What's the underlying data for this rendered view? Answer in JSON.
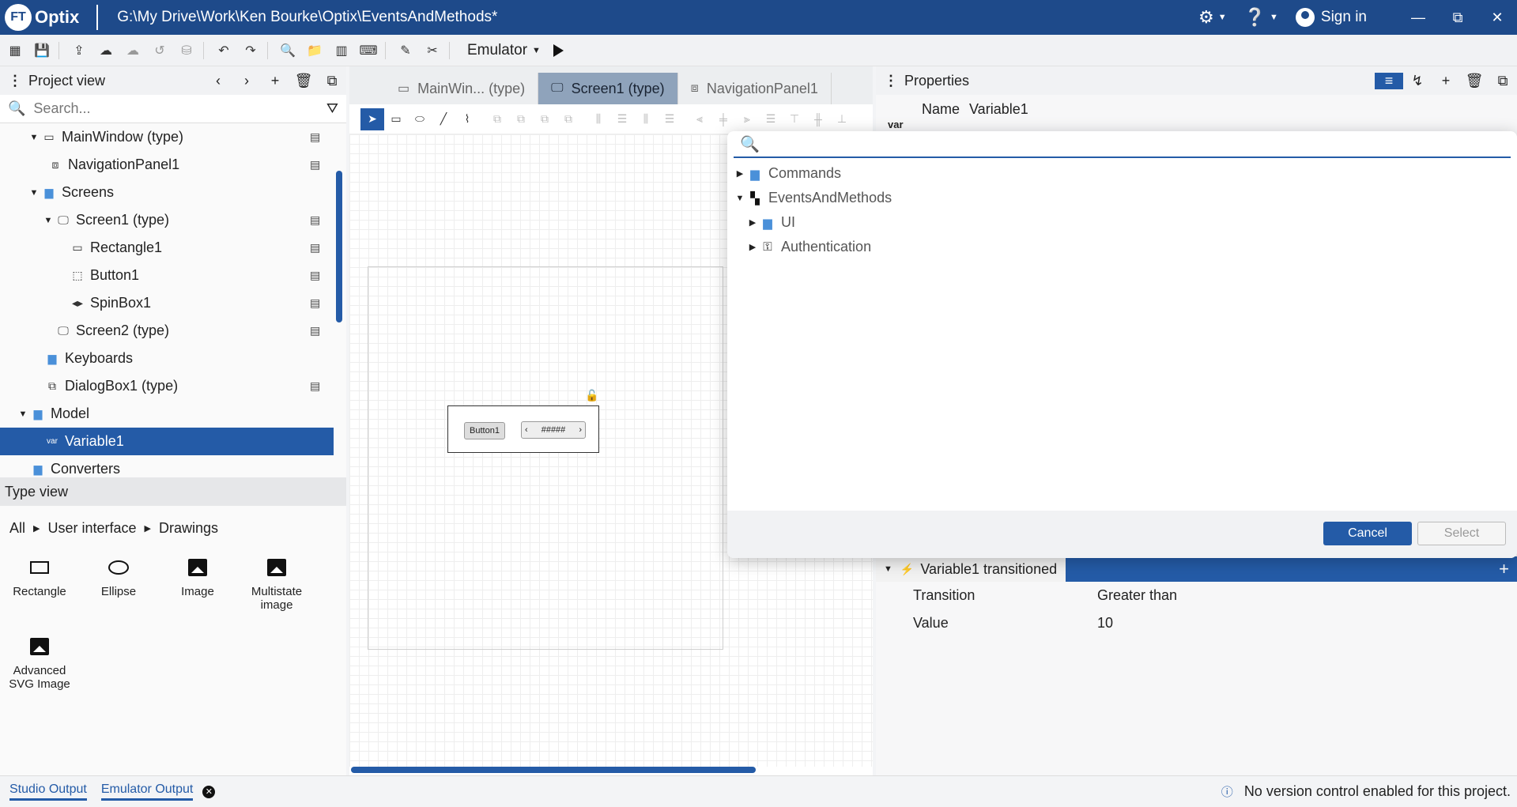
{
  "titlebar": {
    "logo_badge": "FT",
    "app_name": "Optix",
    "path": "G:\\My Drive\\Work\\Ken Bourke\\Optix\\EventsAndMethods*",
    "sign_in": "Sign in",
    "minimize": "—",
    "restore": "⧉",
    "close": "✕"
  },
  "toolbar": {
    "emulator_label": "Emulator"
  },
  "project_view": {
    "title": "Project view",
    "search_placeholder": "Search...",
    "tree": [
      {
        "label": "MainWindow (type)",
        "icon": "window-icon"
      },
      {
        "label": "NavigationPanel1",
        "icon": "navigation-panel-icon"
      },
      {
        "label": "Screens",
        "icon": "folder-icon"
      },
      {
        "label": "Screen1 (type)",
        "icon": "screen-icon"
      },
      {
        "label": "Rectangle1",
        "icon": "rectangle-icon"
      },
      {
        "label": "Button1",
        "icon": "button-icon"
      },
      {
        "label": "SpinBox1",
        "icon": "spinbox-icon"
      },
      {
        "label": "Screen2 (type)",
        "icon": "screen-icon"
      },
      {
        "label": "Keyboards",
        "icon": "folder-icon"
      },
      {
        "label": "DialogBox1 (type)",
        "icon": "dialog-icon"
      },
      {
        "label": "Model",
        "icon": "folder-icon"
      },
      {
        "label": "Variable1",
        "icon": "variable-icon",
        "tag": "var"
      },
      {
        "label": "Converters",
        "icon": "folder-icon"
      }
    ]
  },
  "type_view": {
    "title": "Type view",
    "breadcrumb": [
      "All",
      "User interface",
      "Drawings"
    ],
    "items": [
      {
        "label": "Rectangle"
      },
      {
        "label": "Ellipse"
      },
      {
        "label": "Image"
      },
      {
        "label": "Multistate image"
      },
      {
        "label": "Advanced SVG Image"
      }
    ]
  },
  "editor": {
    "tabs": [
      {
        "label": "MainWin... (type)"
      },
      {
        "label": "Screen1 (type)"
      },
      {
        "label": "NavigationPanel1"
      }
    ],
    "canvas": {
      "button_label": "Button1",
      "spin_value": "#####"
    }
  },
  "properties": {
    "title": "Properties",
    "var_tag": "var",
    "name_label": "Name",
    "name_value": "Variable1",
    "event_title": "Variable1 transitioned",
    "rows": [
      {
        "label": "Transition",
        "value": "Greater than"
      },
      {
        "label": "Value",
        "value": "10"
      }
    ]
  },
  "dialog": {
    "search_value": "",
    "tree": [
      {
        "label": "Commands"
      },
      {
        "label": "EventsAndMethods"
      },
      {
        "label": "UI"
      },
      {
        "label": "Authentication"
      }
    ],
    "cancel_label": "Cancel",
    "select_label": "Select"
  },
  "statusbar": {
    "studio_output": "Studio Output",
    "emulator_output": "Emulator Output",
    "version_msg": "No version control enabled for this project."
  },
  "colors": {
    "brand": "#1e4a8a",
    "accent": "#245ba7"
  }
}
